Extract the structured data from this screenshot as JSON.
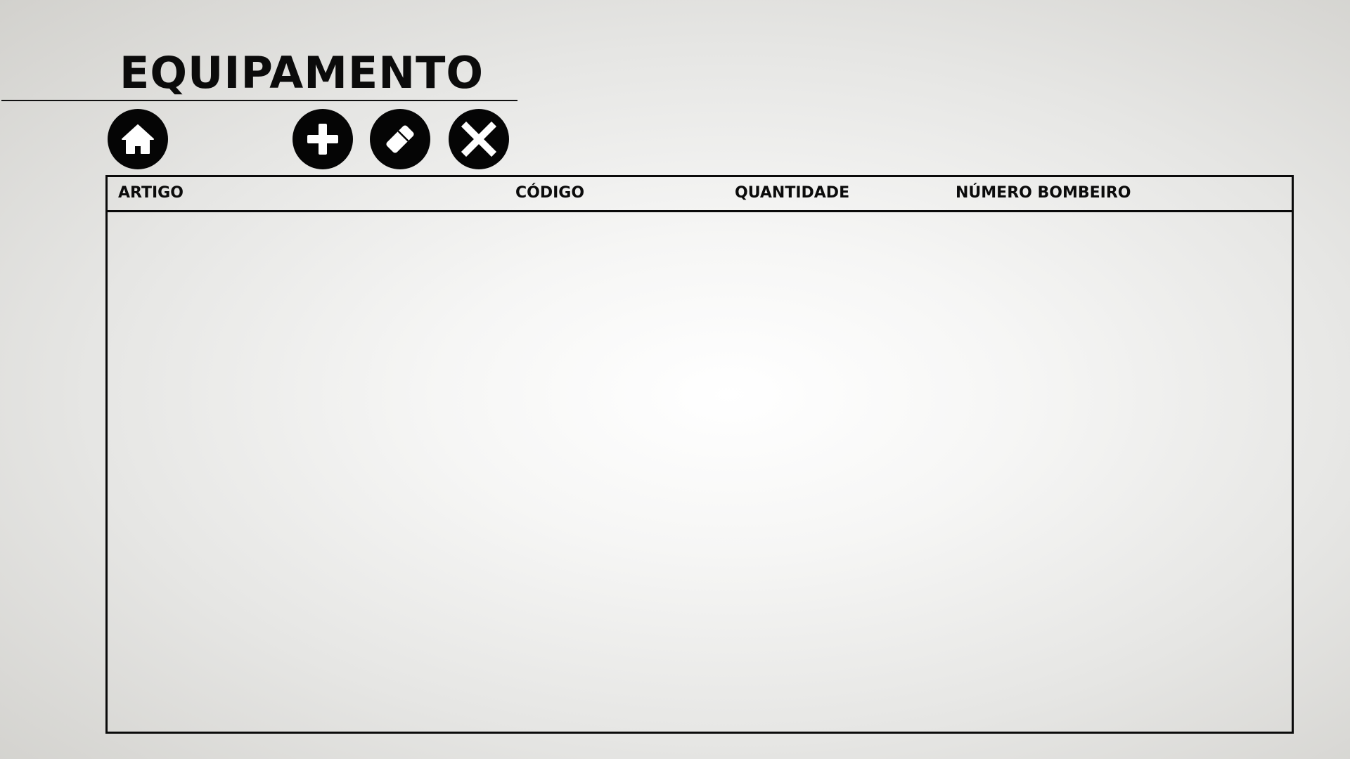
{
  "page": {
    "title": "EQUIPAMENTO"
  },
  "toolbar": {
    "home_icon": "home-icon",
    "add_icon": "plus-icon",
    "edit_icon": "eraser-icon",
    "delete_icon": "close-icon"
  },
  "table": {
    "columns": [
      "ARTIGO",
      "CÓDIGO",
      "QUANTIDADE",
      "NÚMERO BOMBEIRO"
    ],
    "rows": []
  },
  "colors": {
    "foreground": "#0b0b0b",
    "background_center": "#ffffff",
    "background_edge": "#d2d1cd"
  }
}
